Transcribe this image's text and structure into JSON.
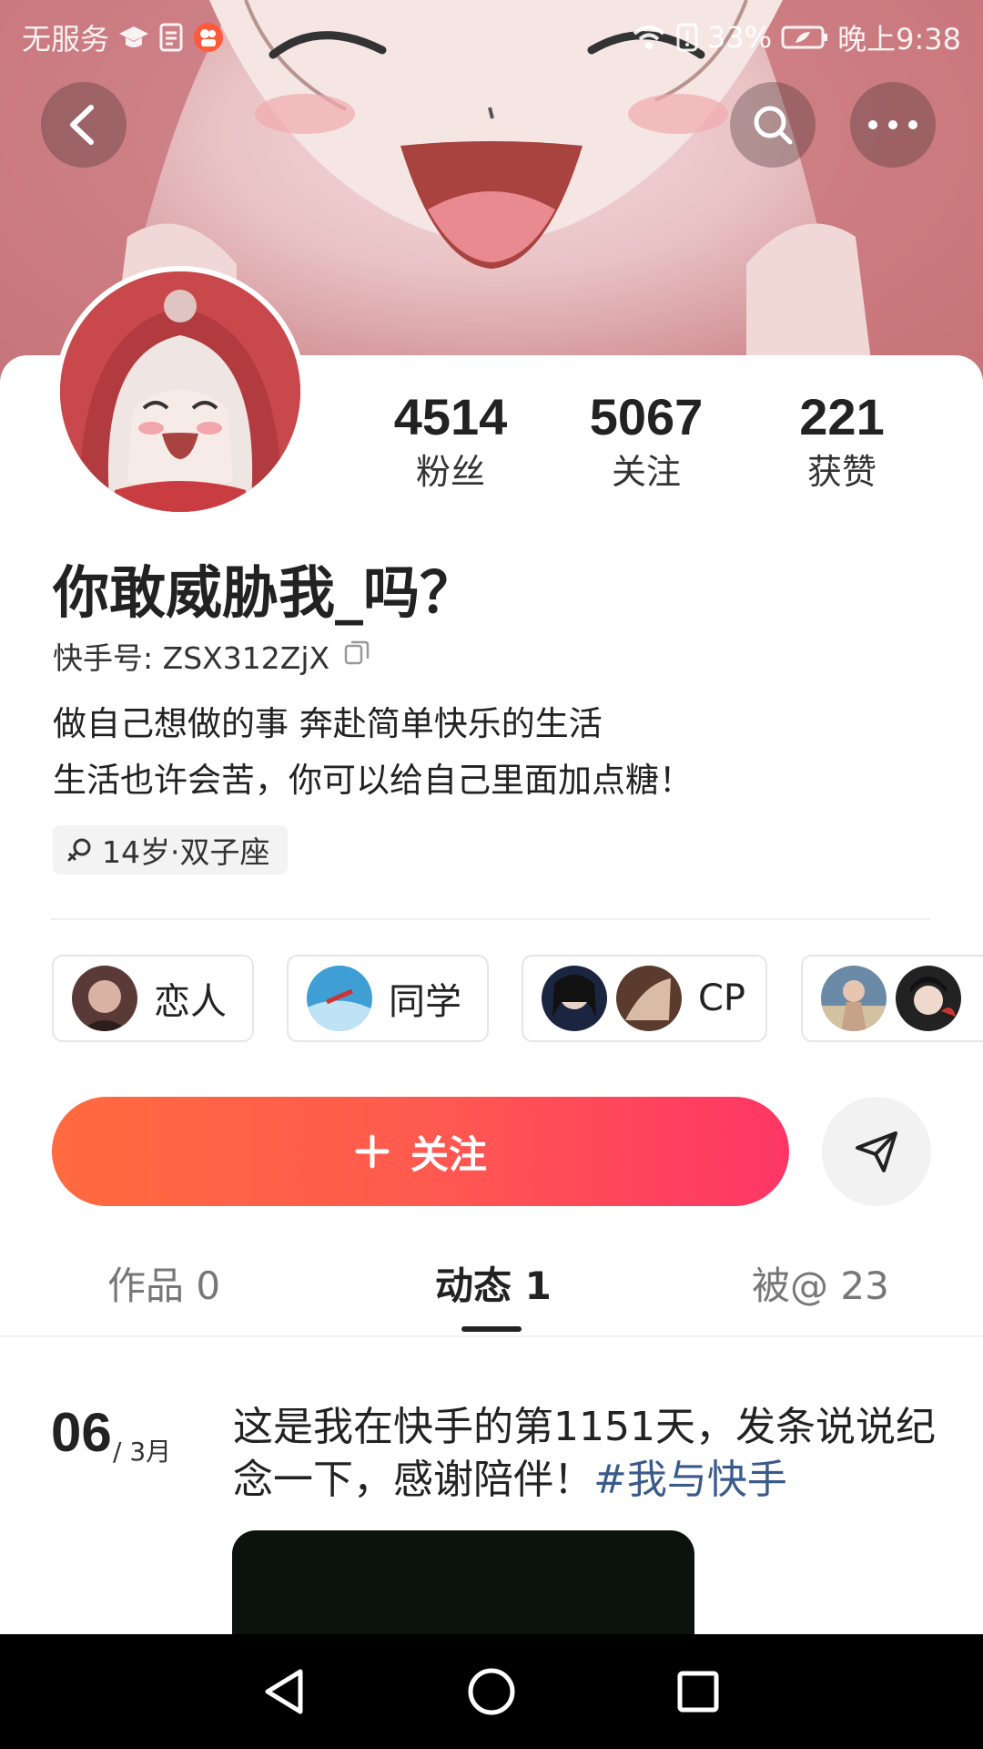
{
  "status_bar": {
    "carrier": "无服务",
    "battery": "33%",
    "time": "晚上9:38"
  },
  "header": {
    "back_icon": "chevron-left-icon",
    "search_icon": "search-icon",
    "more_icon": "more-horizontal-icon"
  },
  "profile": {
    "stats": [
      {
        "value": "4514",
        "label": "粉丝"
      },
      {
        "value": "5067",
        "label": "关注"
      },
      {
        "value": "221",
        "label": "获赞"
      }
    ],
    "nickname": "你敢威胁我_吗？",
    "kuaishou_id": "快手号: ZSX312ZjX",
    "bio_line1": "做自己想做的事 奔赴简单快乐的生活",
    "bio_line2": "生活也许会苦，你可以给自己里面加点糖！",
    "tag": "14岁·双子座"
  },
  "relations": [
    {
      "label": "恋人"
    },
    {
      "label": "同学"
    },
    {
      "label": "CP"
    },
    {
      "label": ""
    }
  ],
  "actions": {
    "follow_label": "关注",
    "follow_color": "#fe3666",
    "share_icon": "send-icon"
  },
  "tabs": [
    {
      "label": "作品 0"
    },
    {
      "label": "动态 1"
    },
    {
      "label": "被@ 23"
    }
  ],
  "post": {
    "day": "06",
    "month": "/ 3月",
    "text": "这是我在快手的第1151天，发条说说纪念一下，感谢陪伴！",
    "hashtag": "#我与快手"
  },
  "navbar": {
    "back": "triangle-back-icon",
    "home": "circle-home-icon",
    "recents": "square-recents-icon"
  }
}
